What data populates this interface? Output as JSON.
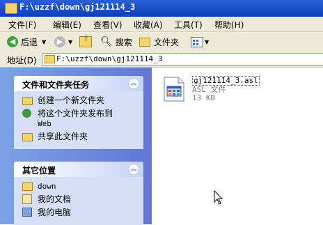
{
  "window": {
    "title": "F:\\uzzf\\down\\gj121114_3"
  },
  "menu": [
    {
      "label": "文件(F)"
    },
    {
      "label": "编辑(E)"
    },
    {
      "label": "查看(V)"
    },
    {
      "label": "收藏(A)"
    },
    {
      "label": "工具(T)"
    },
    {
      "label": "帮助(H)"
    }
  ],
  "toolbar": {
    "back_label": "后退",
    "search_label": "搜索",
    "folders_label": "文件夹"
  },
  "address": {
    "label": "地址(D)",
    "value": "F:\\uzzf\\down\\gj121114_3"
  },
  "tasks": {
    "title": "文件和文件夹任务",
    "items": [
      {
        "label": "创建一个新文件夹"
      },
      {
        "label": "将这个文件夹发布到",
        "sub": "Web"
      },
      {
        "label": "共享此文件夹"
      }
    ]
  },
  "places": {
    "title": "其它位置",
    "items": [
      {
        "label": "down"
      },
      {
        "label": "我的文档"
      },
      {
        "label": "我的电脑"
      }
    ]
  },
  "file": {
    "name": "gj121114_3.asl",
    "type": "ASL 文件",
    "size": "13 KB"
  }
}
